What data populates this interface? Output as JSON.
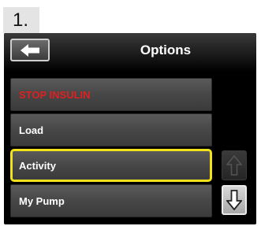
{
  "step_label": "1.",
  "header": {
    "title": "Options",
    "back_icon": "arrow-left-icon"
  },
  "menu": {
    "items": [
      {
        "label": "STOP INSULIN",
        "state": "danger"
      },
      {
        "label": "Load",
        "state": "normal"
      },
      {
        "label": "Activity",
        "state": "selected"
      },
      {
        "label": "My Pump",
        "state": "normal"
      }
    ]
  },
  "scroll": {
    "up_icon": "arrow-up-icon",
    "down_icon": "arrow-down-icon",
    "up_enabled": false,
    "down_enabled": true
  },
  "colors": {
    "danger": "#e02020",
    "highlight": "#f2e21a",
    "screen_bg": "#000000"
  }
}
